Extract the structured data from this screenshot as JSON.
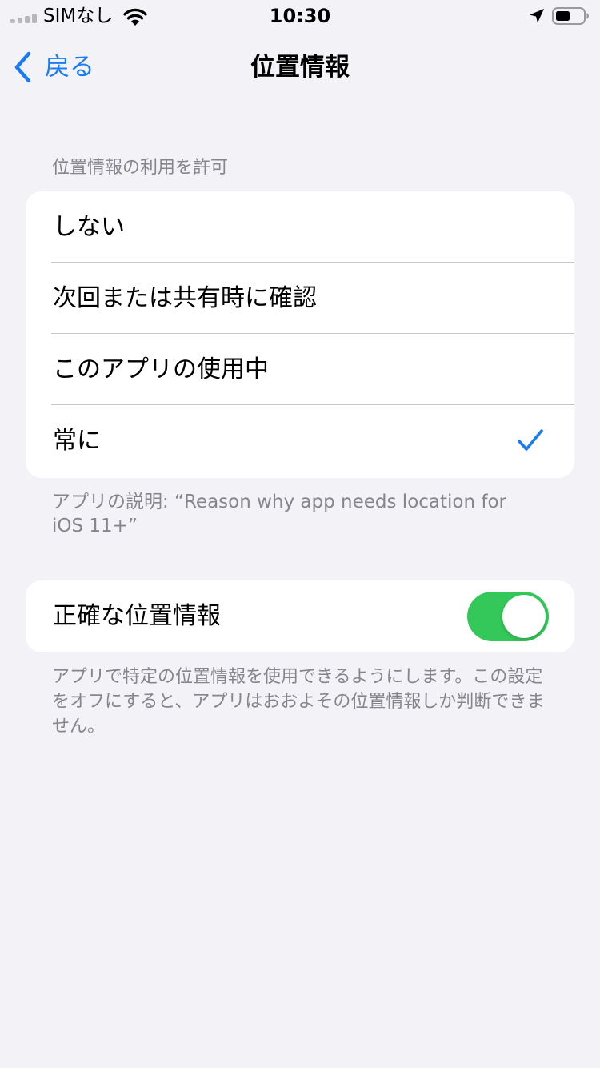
{
  "status_bar": {
    "carrier": "SIMなし",
    "time": "10:30"
  },
  "nav": {
    "back_label": "戻る",
    "title": "位置情報"
  },
  "location_access": {
    "header": "位置情報の利用を許可",
    "options": [
      {
        "label": "しない",
        "selected": false
      },
      {
        "label": "次回または共有時に確認",
        "selected": false
      },
      {
        "label": "このアプリの使用中",
        "selected": false
      },
      {
        "label": "常に",
        "selected": true
      }
    ],
    "footer": "アプリの説明: “Reason why app needs location for iOS 11+”"
  },
  "precise_location": {
    "label": "正確な位置情報",
    "enabled": true,
    "footer": "アプリで特定の位置情報を使用できるようにします。この設定をオフにすると、アプリはおおよその位置情報しか判断できません。"
  },
  "colors": {
    "accent": "#1a7cf5",
    "toggle_on": "#34c759",
    "background": "#f2f2f7",
    "secondary_text": "#85858b"
  }
}
